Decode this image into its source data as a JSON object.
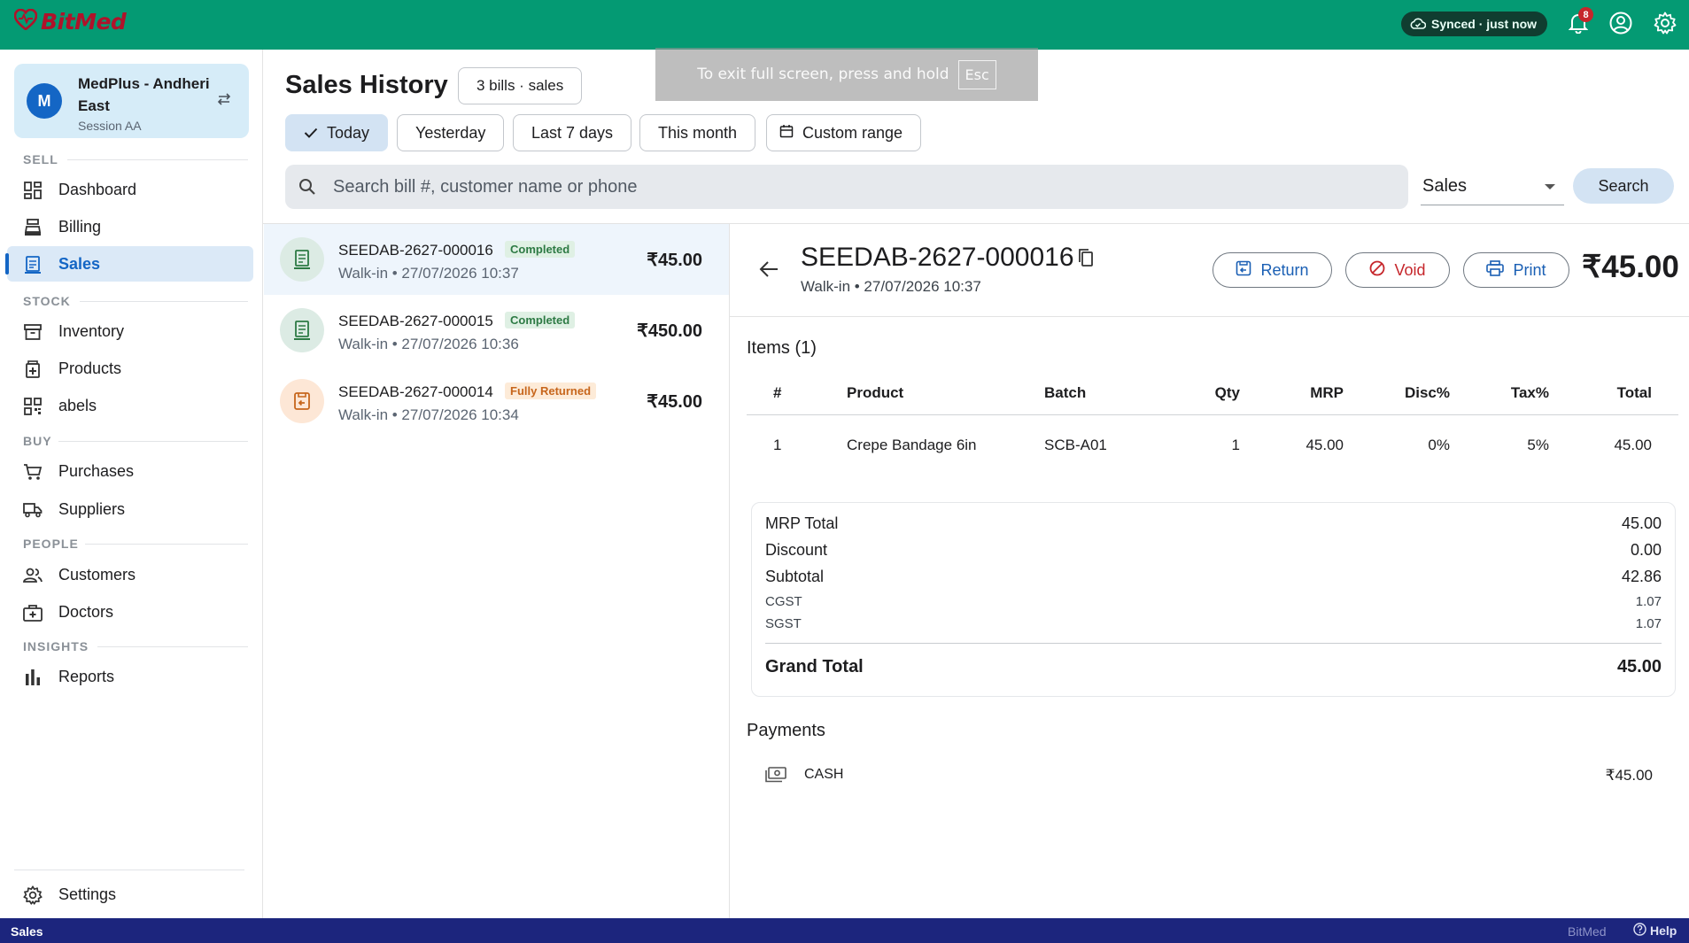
{
  "header": {
    "brand": "BitMed",
    "sync_status": "Synced · just now",
    "notification_count": "8"
  },
  "fullscreen_notice": {
    "text": "To exit full screen, press and hold",
    "key": "Esc"
  },
  "sidebar": {
    "store": {
      "avatar_letter": "M",
      "name": "MedPlus - Andheri East",
      "session": "Session AA"
    },
    "sections": {
      "sell": "SELL",
      "stock": "STOCK",
      "buy": "BUY",
      "people": "PEOPLE",
      "insights": "INSIGHTS"
    },
    "items": {
      "dashboard": "Dashboard",
      "billing": "Billing",
      "sales": "Sales",
      "inventory": "Inventory",
      "products": "Products",
      "labels": "abels",
      "purchases": "Purchases",
      "suppliers": "Suppliers",
      "customers": "Customers",
      "doctors": "Doctors",
      "reports": "Reports",
      "settings": "Settings"
    }
  },
  "page": {
    "title": "Sales History",
    "count_chip": "3 bills · sales",
    "filters": {
      "today": "Today",
      "yesterday": "Yesterday",
      "last7": "Last 7 days",
      "month": "This month",
      "custom": "Custom range"
    },
    "search": {
      "placeholder": "Search bill #, customer name or phone",
      "type": "Sales",
      "button": "Search"
    }
  },
  "bills": [
    {
      "number": "SEEDAB-2627-000016",
      "status": "Completed",
      "sub": "Walk-in • 27/07/2026 10:37",
      "amount": "₹45.00"
    },
    {
      "number": "SEEDAB-2627-000015",
      "status": "Completed",
      "sub": "Walk-in • 27/07/2026 10:36",
      "amount": "₹450.00"
    },
    {
      "number": "SEEDAB-2627-000014",
      "status": "Fully Returned",
      "sub": "Walk-in • 27/07/2026 10:34",
      "amount": "₹45.00"
    }
  ],
  "detail": {
    "number": "SEEDAB-2627-000016",
    "sub": "Walk-in • 27/07/2026 10:37",
    "actions": {
      "return": "Return",
      "void": "Void",
      "print": "Print"
    },
    "amount": "₹45.00",
    "items_title": "Items (1)",
    "columns": [
      "#",
      "Product",
      "Batch",
      "Qty",
      "MRP",
      "Disc%",
      "Tax%",
      "Total"
    ],
    "rows": [
      [
        "1",
        "Crepe Bandage 6in",
        "SCB-A01",
        "1",
        "45.00",
        "0%",
        "5%",
        "45.00"
      ]
    ],
    "summary": {
      "mrp_total_label": "MRP Total",
      "mrp_total": "45.00",
      "discount_label": "Discount",
      "discount": "0.00",
      "subtotal_label": "Subtotal",
      "subtotal": "42.86",
      "cgst_label": "CGST",
      "cgst": "1.07",
      "sgst_label": "SGST",
      "sgst": "1.07",
      "grand_total_label": "Grand Total",
      "grand_total": "45.00"
    },
    "payments_title": "Payments",
    "payments": [
      {
        "method": "CASH",
        "amount": "₹45.00"
      }
    ]
  },
  "statusbar": {
    "section": "Sales",
    "brand": "BitMed",
    "help": "Help"
  },
  "colors": {
    "topbar": "#049a73",
    "accent": "#1466c5",
    "statusbar": "#1c257d",
    "danger": "#c6262b",
    "completed": "#2d7a44",
    "returned": "#c7661c"
  }
}
